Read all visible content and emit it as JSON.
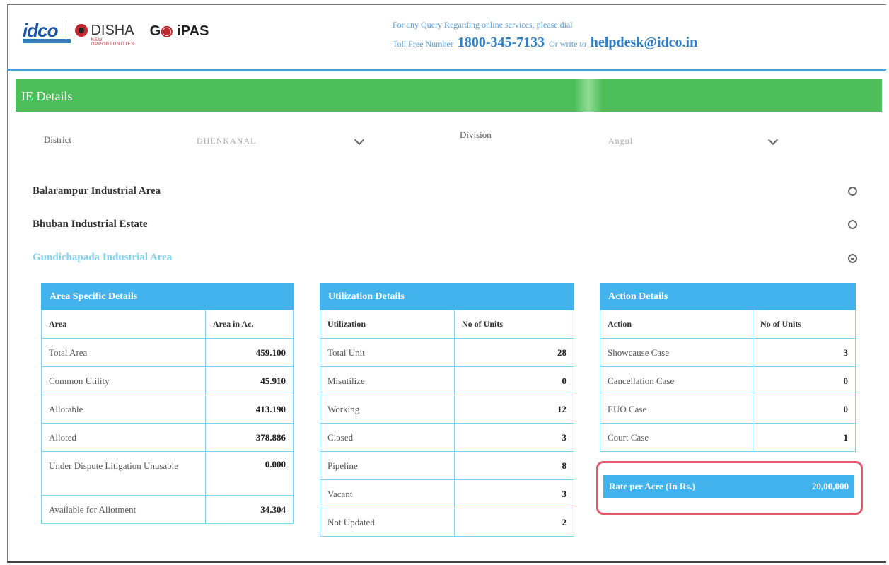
{
  "header": {
    "logo_idco": "idco",
    "logo_odisha": "DISHA",
    "logo_odisha_sub": "NEW OPPORTUNITIES",
    "logo_goipas_a": "G",
    "logo_goipas_b": "iPAS",
    "contact_line1": "For any Query Regarding online services, please dial",
    "toll_free_label": "Toll Free Number",
    "phone": "1800-345-7133",
    "or_write": "Or write to",
    "email": "helpdesk@idco.in"
  },
  "section": {
    "title": "IE Details"
  },
  "filters": {
    "district_label": "District",
    "district_value": "DHENKANAL",
    "division_label": "Division",
    "division_value": "Angul"
  },
  "accordion": [
    {
      "label": "Balarampur Industrial Area",
      "state": "collapsed"
    },
    {
      "label": "Bhuban Industrial Estate",
      "state": "collapsed"
    },
    {
      "label": "Gundichapada Industrial Area",
      "state": "expanded"
    }
  ],
  "area_details": {
    "title": "Area Specific Details",
    "headers": [
      "Area",
      "Area in Ac."
    ],
    "rows": [
      [
        "Total Area",
        "459.100"
      ],
      [
        "Common Utility",
        "45.910"
      ],
      [
        "Allotable",
        "413.190"
      ],
      [
        "Alloted",
        "378.886"
      ],
      [
        "Under Dispute Litigation Unusable",
        "0.000"
      ],
      [
        "Available for Allotment",
        "34.304"
      ]
    ]
  },
  "utilization_details": {
    "title": "Utilization Details",
    "headers": [
      "Utilization",
      "No of Units"
    ],
    "rows": [
      [
        "Total Unit",
        "28"
      ],
      [
        "Misutilize",
        "0"
      ],
      [
        "Working",
        "12"
      ],
      [
        "Closed",
        "3"
      ],
      [
        "Pipeline",
        "8"
      ],
      [
        "Vacant",
        "3"
      ],
      [
        "Not Updated",
        "2"
      ]
    ]
  },
  "action_details": {
    "title": "Action Details",
    "headers": [
      "Action",
      "No of Units"
    ],
    "rows": [
      [
        "Showcause Case",
        "3"
      ],
      [
        "Cancellation Case",
        "0"
      ],
      [
        "EUO Case",
        "0"
      ],
      [
        "Court Case",
        "1"
      ]
    ]
  },
  "rate": {
    "label": "Rate per Acre (In Rs.)",
    "value": "20,00,000"
  },
  "colors": {
    "green_bar": "#4dbe5a",
    "table_header": "#42b3ec",
    "highlight": "#e05a6d"
  }
}
